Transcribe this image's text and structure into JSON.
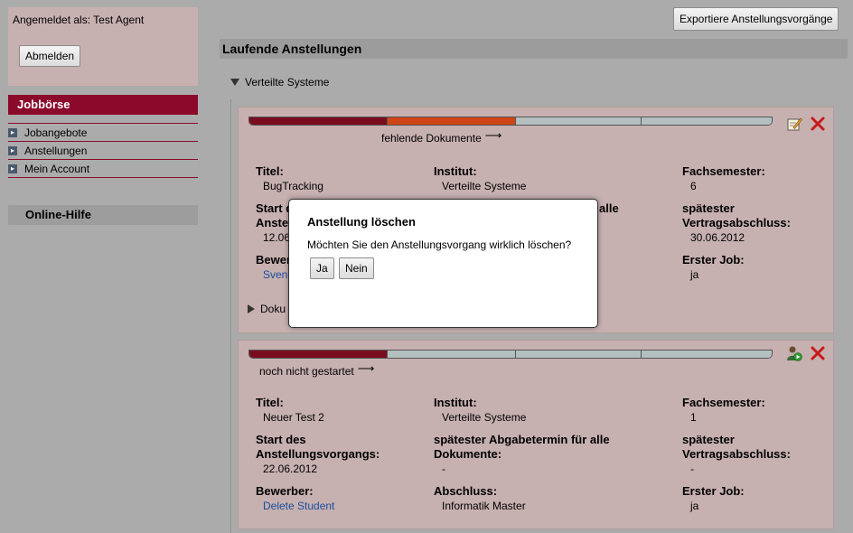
{
  "sidebar": {
    "logged_in_text": "Angemeldet als: Test Agent",
    "logout_label": "Abmelden",
    "nav_title": "Jobbörse",
    "nav_items": [
      {
        "label": "Jobangebote"
      },
      {
        "label": "Anstellungen"
      },
      {
        "label": "Mein Account"
      }
    ],
    "help_title": "Online-Hilfe"
  },
  "header": {
    "export_label": "Exportiere Anstellungsvorgänge"
  },
  "main": {
    "section_title": "Laufende Anstellungen",
    "group_label": "Verteilte Systeme",
    "cards": [
      {
        "progress": [
          1,
          1,
          0,
          0
        ],
        "status_label": "fehlende Dokumente",
        "title_label": "Titel:",
        "title_value": "BugTracking",
        "institute_label": "Institut:",
        "institute_value": "Verteilte Systeme",
        "semester_label": "Fachsemester:",
        "semester_value": "6",
        "start_label_1": "Start d",
        "start_label_2": "Anste",
        "start_value": "12.06",
        "deadline_label_1": "alle",
        "contract_label_1": "spätester",
        "contract_label_2": "Vertragsabschluss:",
        "contract_value": "30.06.2012",
        "applicant_label": "Bewerb",
        "applicant_value": "Sven",
        "first_job_label": "Erster Job:",
        "first_job_value": "ja",
        "docs_label": "Doku"
      },
      {
        "progress": [
          1,
          0,
          0,
          0
        ],
        "status_label": "noch nicht gestartet",
        "title_label": "Titel:",
        "title_value": "Neuer Test 2",
        "institute_label": "Institut:",
        "institute_value": "Verteilte Systeme",
        "semester_label": "Fachsemester:",
        "semester_value": "1",
        "start_label_1": "Start des",
        "start_label_2": "Anstellungsvorgangs:",
        "start_value": "22.06.2012",
        "deadline_label_1": "spätester Abgabetermin für alle",
        "deadline_label_2": "Dokumente:",
        "deadline_value": "-",
        "contract_label_1": "spätester",
        "contract_label_2": "Vertragsabschluss:",
        "contract_value": "-",
        "applicant_label": "Bewerber:",
        "applicant_value": "Delete Student",
        "degree_label": "Abschluss:",
        "degree_value": "Informatik Master",
        "first_job_label": "Erster Job:",
        "first_job_value": "ja"
      }
    ]
  },
  "modal": {
    "title": "Anstellung löschen",
    "text": "Möchten Sie den Anstellungsvorgang wirklich löschen?",
    "yes_label": "Ja",
    "no_label": "Nein"
  },
  "colors": {
    "accent": "#8b0a2c",
    "progress_done": "#7a0c20",
    "progress_active": "#d04515",
    "card_bg": "#c7b0b0",
    "link": "#1a4fa0"
  },
  "icons": [
    "edit-icon",
    "delete-icon",
    "start-process-icon",
    "nav-bullet-icon",
    "collapse-triangle-icon",
    "expand-triangle-icon",
    "return-arrow-icon"
  ]
}
